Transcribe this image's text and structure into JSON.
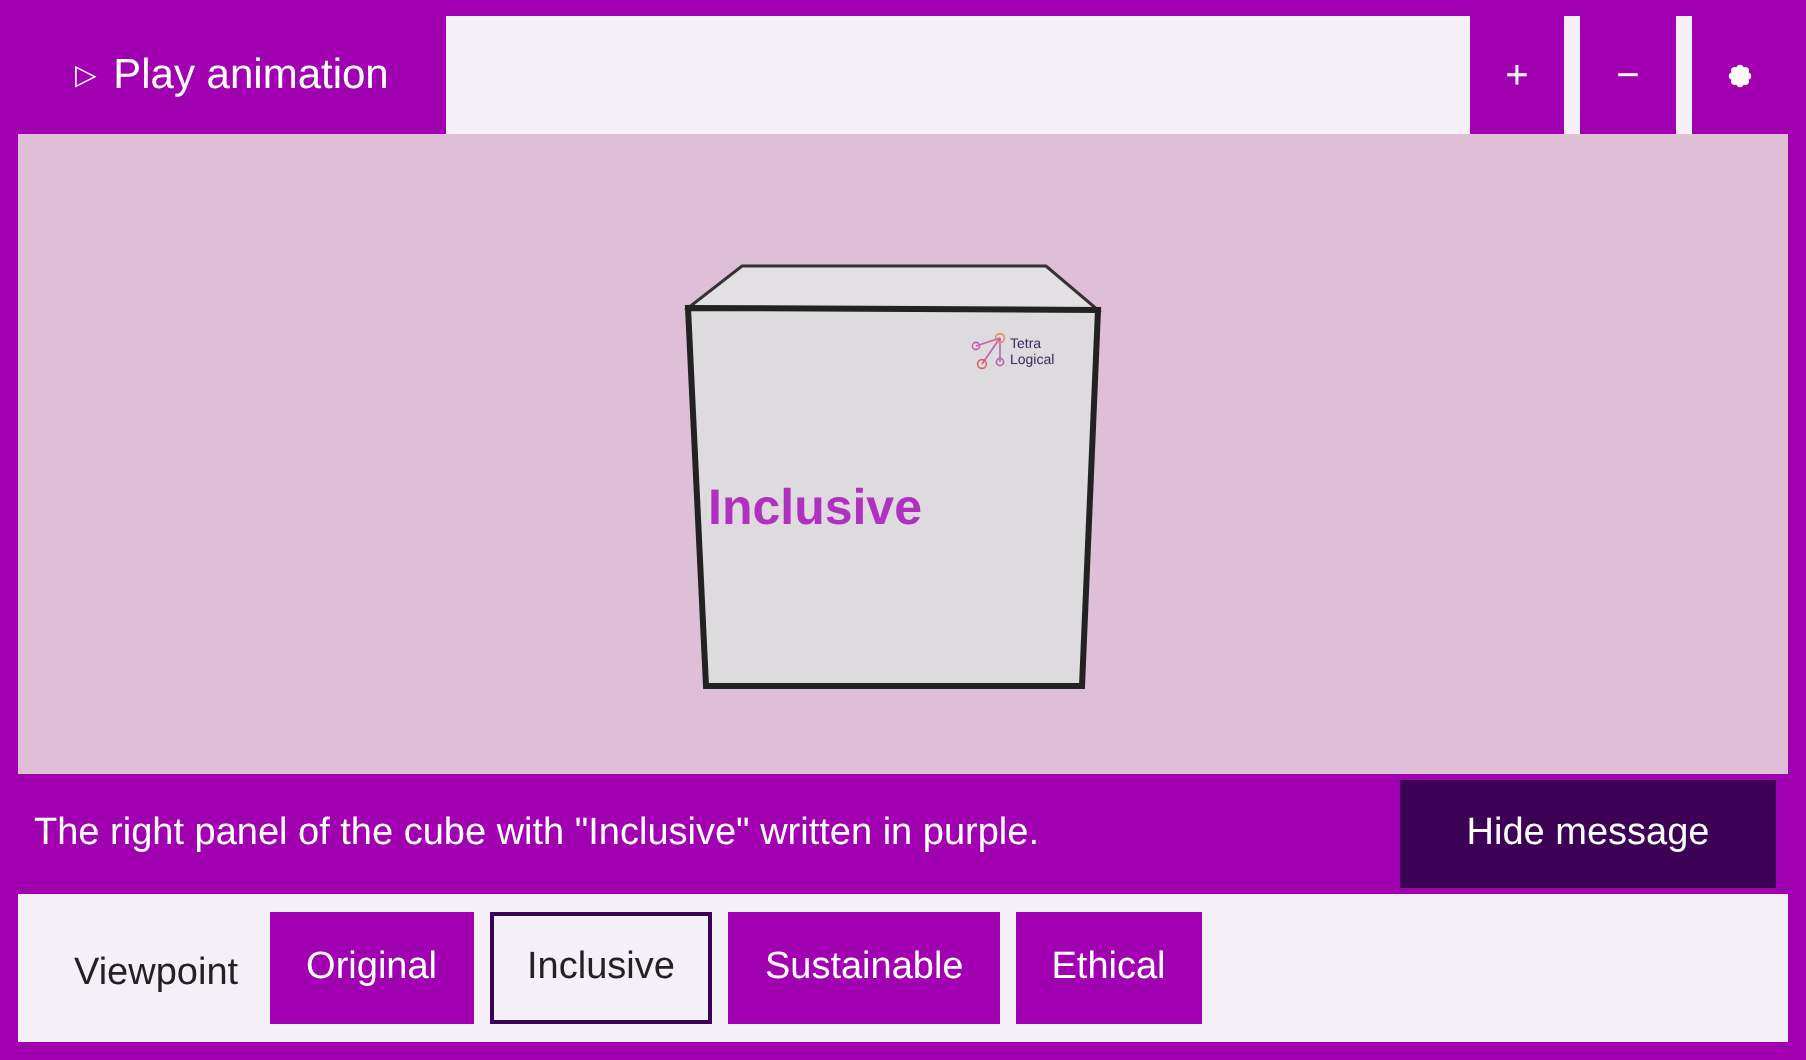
{
  "toolbar": {
    "play_button": {
      "icon": "▷",
      "label": "Play animation"
    },
    "zoom_in": "+",
    "zoom_out": "−"
  },
  "cube": {
    "face_text": "Inclusive",
    "logo_lines": [
      "Tetra",
      "Logical"
    ]
  },
  "message": {
    "text": "The right panel of the cube with \"Inclusive\" written in purple.",
    "hide_button": "Hide message"
  },
  "viewpoint": {
    "label": "Viewpoint",
    "options": [
      {
        "label": "Original",
        "selected": false
      },
      {
        "label": "Inclusive",
        "selected": true
      },
      {
        "label": "Sustainable",
        "selected": false
      },
      {
        "label": "Ethical",
        "selected": false
      }
    ]
  }
}
